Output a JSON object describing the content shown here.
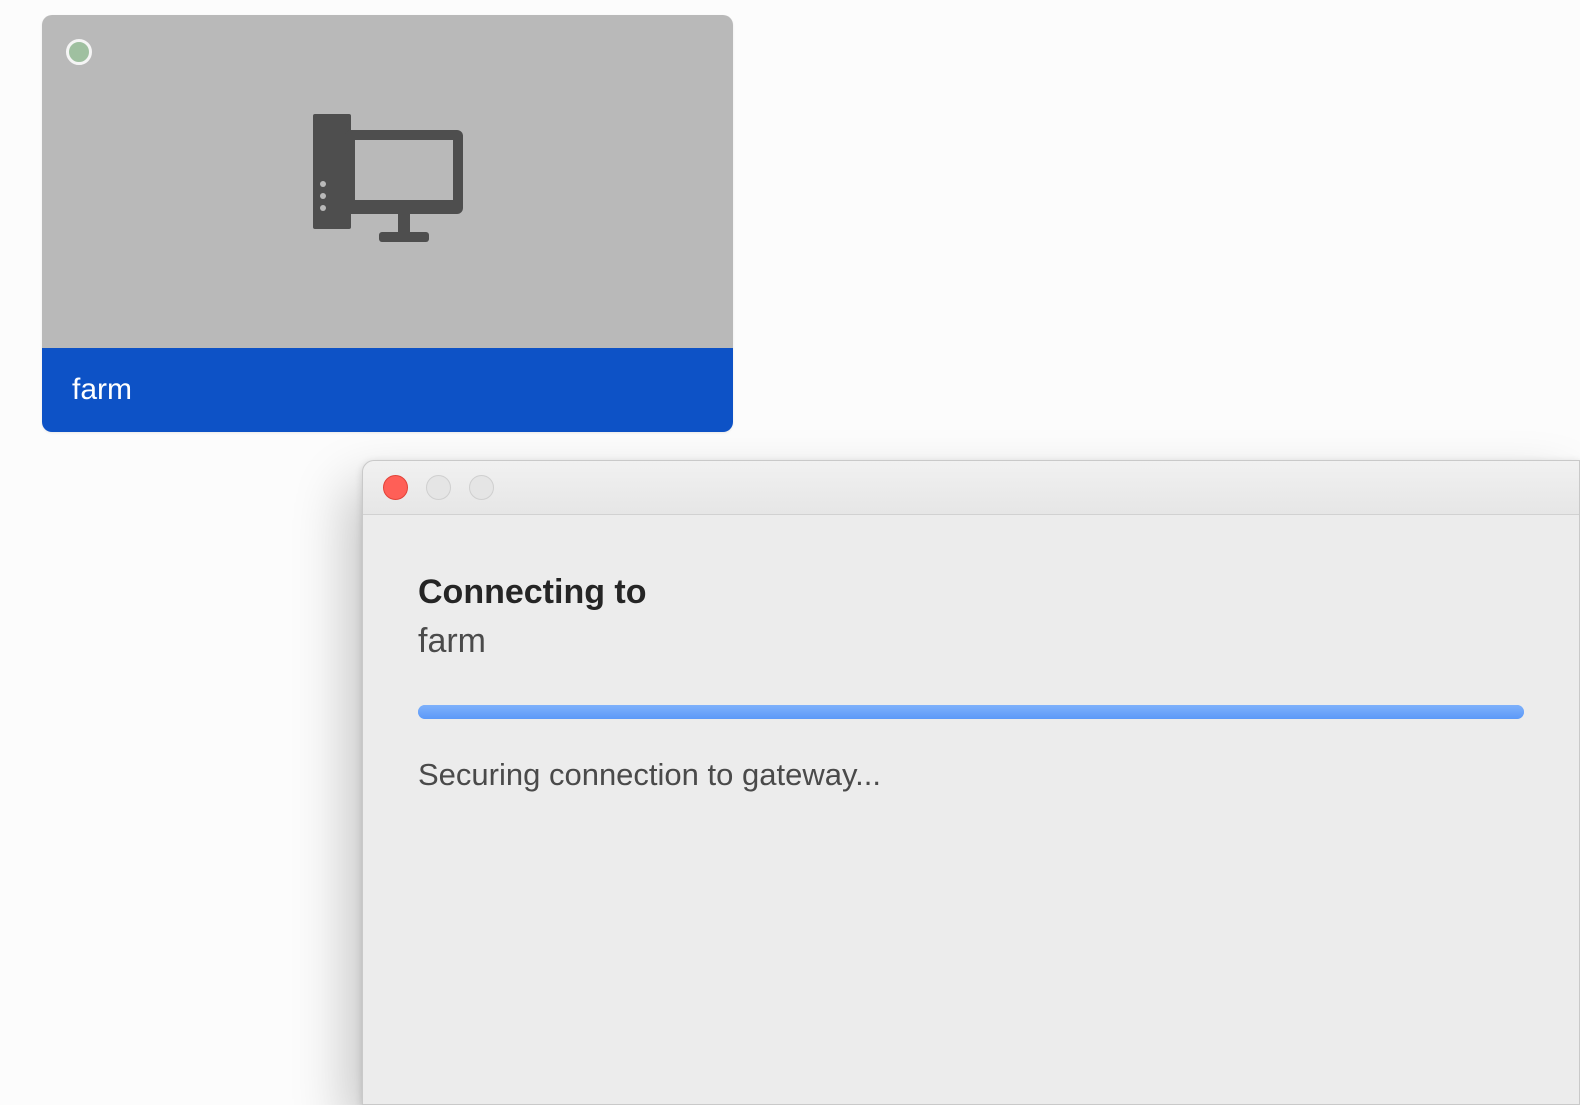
{
  "tile": {
    "name": "farm",
    "status_indicator": "online",
    "icon": "desktop-computer-icon",
    "colors": {
      "footer_bg": "#0d52c6",
      "top_bg": "#b9b9b9",
      "status_dot": "#9fc0a0"
    }
  },
  "dialog": {
    "heading": "Connecting to",
    "target": "farm",
    "status": "Securing connection to gateway...",
    "progress": {
      "indeterminate": true,
      "color": "#6ea6f9"
    },
    "traffic_lights": {
      "close_enabled": true,
      "minimize_enabled": false,
      "zoom_enabled": false
    }
  }
}
